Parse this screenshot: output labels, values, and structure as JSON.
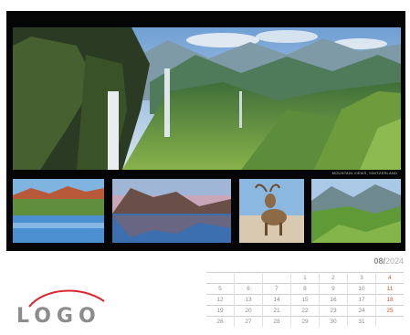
{
  "photo_caption": "MOUNTAIN VIEWS, SWITZERLAND",
  "logo": {
    "text": "LOGO",
    "arc_color": "#d9262f"
  },
  "calendar": {
    "month": "08",
    "year": "2024",
    "weekend_color": "#e3572b",
    "weeks": [
      [
        "",
        "",
        "",
        "1",
        "2",
        "3",
        "4"
      ],
      [
        "5",
        "6",
        "7",
        "8",
        "9",
        "10",
        "11"
      ],
      [
        "12",
        "13",
        "14",
        "15",
        "16",
        "17",
        "18"
      ],
      [
        "19",
        "20",
        "21",
        "22",
        "23",
        "24",
        "25"
      ],
      [
        "26",
        "27",
        "28",
        "29",
        "30",
        "31",
        ""
      ]
    ]
  }
}
